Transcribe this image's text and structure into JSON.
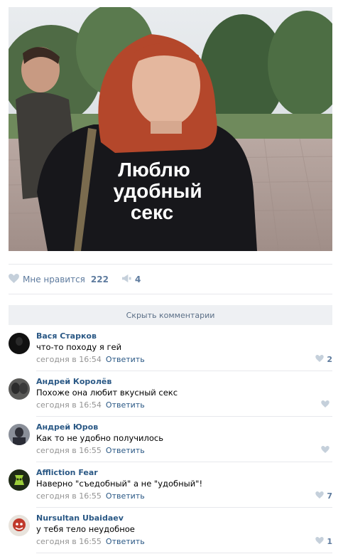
{
  "post": {
    "photo": {
      "icon": "photo-woman-tshirt",
      "shirt_text": [
        "Люблю",
        "удобный",
        "секс"
      ]
    },
    "likes": {
      "label": "Мне нравится",
      "count": "222",
      "icon": "heart-icon"
    },
    "shares": {
      "count": "4",
      "icon": "megaphone-icon"
    }
  },
  "comments_toggle": {
    "label": "Скрыть комментарии"
  },
  "comments": [
    {
      "author": "Вася Старков",
      "text": "что-то походу я гей",
      "date": "сегодня в 16:54",
      "reply": "Ответить",
      "likes": "2",
      "avatar_color": "#111111"
    },
    {
      "author": "Андрей Королёв",
      "text": "Похоже она любит вкусный секс",
      "date": "сегодня в 16:54",
      "reply": "Ответить",
      "likes": "",
      "avatar_color": "#3a3a3a"
    },
    {
      "author": "Андрей Юров",
      "text": "Как то не удобно получилось",
      "date": "сегодня в 16:55",
      "reply": "Ответить",
      "likes": "",
      "avatar_color": "#4a4c55"
    },
    {
      "author": "Affliction Fear",
      "text": "Наверно \"съедобный\" а не \"удобный\"!",
      "date": "сегодня в 16:55",
      "reply": "Ответить",
      "likes": "7",
      "avatar_color": "#2b3a1e"
    },
    {
      "author": "Nursultan Ubaidaev",
      "text": "у тебя тело неудобное",
      "date": "сегодня в 16:55",
      "reply": "Ответить",
      "likes": "1",
      "avatar_color": "#c0392b"
    }
  ],
  "colors": {
    "link": "#2a5885",
    "muted": "#939393",
    "action": "#5e7b9e",
    "heart": "#c5d0db"
  }
}
